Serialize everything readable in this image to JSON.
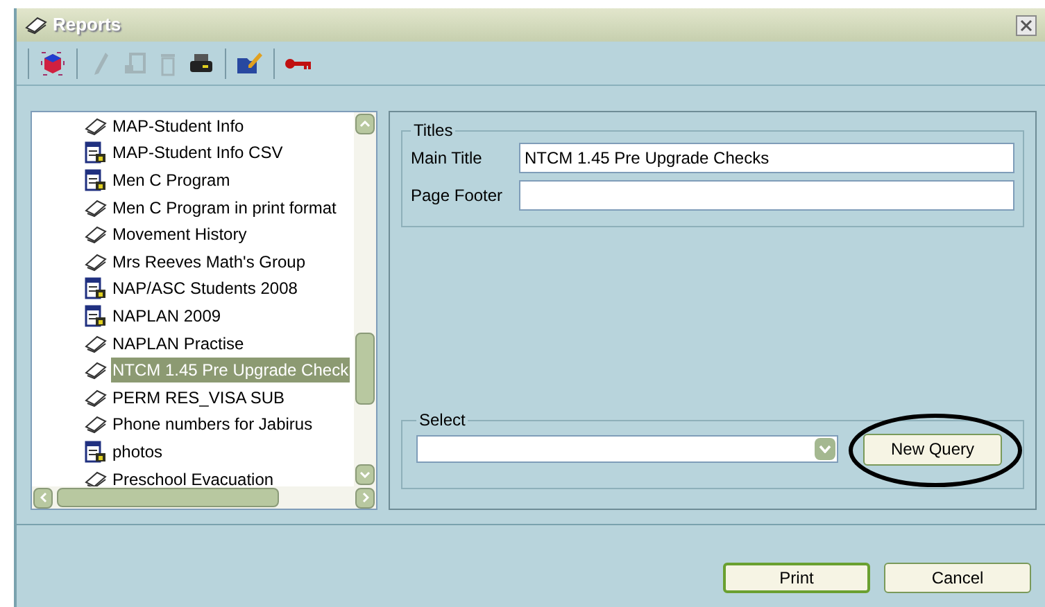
{
  "window": {
    "title": "Reports"
  },
  "toolbar": [
    {
      "kind": "query",
      "disabled": false
    },
    {
      "kind": "edit",
      "disabled": true
    },
    {
      "kind": "export",
      "disabled": true
    },
    {
      "kind": "delete",
      "disabled": true
    },
    {
      "kind": "print",
      "disabled": false
    },
    {
      "kind": "design",
      "disabled": false
    },
    {
      "kind": "key",
      "disabled": false
    }
  ],
  "reports": [
    {
      "kind": "report",
      "label": "MAP-Student Info",
      "selected": false
    },
    {
      "kind": "csv",
      "label": "MAP-Student Info CSV",
      "selected": false
    },
    {
      "kind": "csv",
      "label": "Men C Program",
      "selected": false
    },
    {
      "kind": "report",
      "label": "Men C Program in print format",
      "selected": false
    },
    {
      "kind": "report",
      "label": "Movement History",
      "selected": false
    },
    {
      "kind": "report",
      "label": "Mrs Reeves Math's Group",
      "selected": false
    },
    {
      "kind": "csv",
      "label": "NAP/ASC Students 2008",
      "selected": false
    },
    {
      "kind": "csv",
      "label": "NAPLAN 2009",
      "selected": false
    },
    {
      "kind": "report",
      "label": "NAPLAN Practise",
      "selected": false
    },
    {
      "kind": "report",
      "label": "NTCM 1.45 Pre Upgrade Check",
      "selected": true
    },
    {
      "kind": "report",
      "label": "PERM RES_VISA SUB",
      "selected": false
    },
    {
      "kind": "report",
      "label": "Phone numbers for Jabirus",
      "selected": false
    },
    {
      "kind": "csv",
      "label": "photos",
      "selected": false
    },
    {
      "kind": "report",
      "label": "Preschool Evacuation",
      "selected": false
    }
  ],
  "titles": {
    "legend": "Titles",
    "fields": [
      {
        "label": "Main Title",
        "value": "NTCM 1.45 Pre Upgrade Checks"
      },
      {
        "label": "Page Footer"
      }
    ]
  },
  "select": {
    "legend": "Select",
    "button": "New Query"
  },
  "buttons": [
    "Print",
    "Cancel"
  ]
}
